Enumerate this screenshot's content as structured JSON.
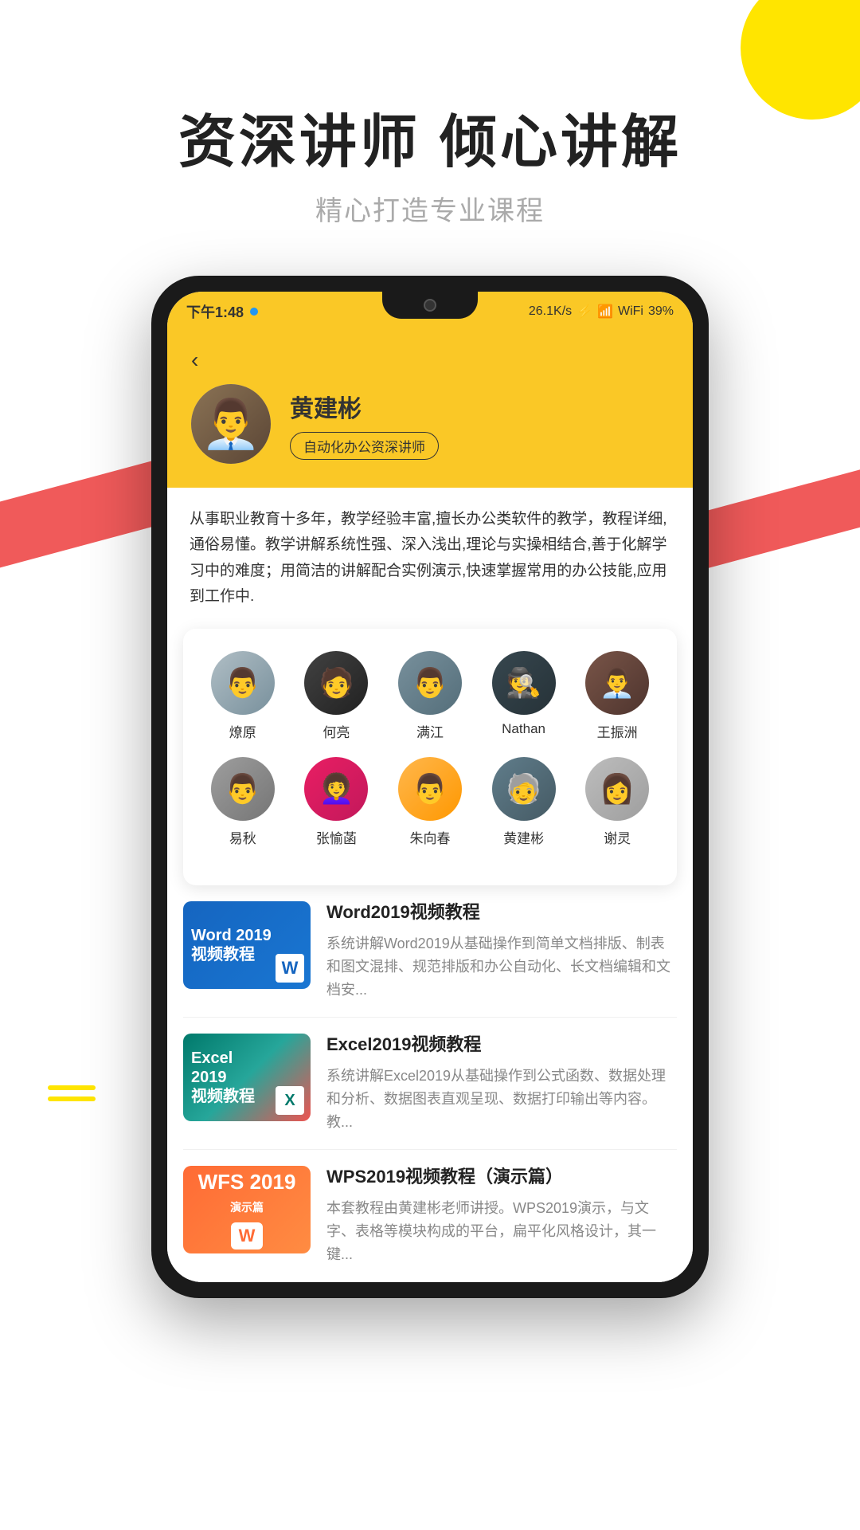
{
  "page": {
    "hero": {
      "title": "资深讲师  倾心讲解",
      "subtitle": "精心打造专业课程"
    },
    "phone": {
      "status_bar": {
        "time": "下午1:48",
        "speed": "26.1K/s",
        "battery": "39%"
      },
      "instructor": {
        "back_label": "‹",
        "name": "黄建彬",
        "badge": "自动化办公资深讲师",
        "description": "从事职业教育十多年，教学经验丰富,擅长办公类软件的教学，教程详细,通俗易懂。教学讲解系统性强、深入浅出,理论与实操相结合,善于化解学习中的难度；用简洁的讲解配合实例演示,快速掌握常用的办公技能,应用到工作中."
      },
      "teachers_row1": [
        {
          "name": "燎原",
          "emoji": "👨"
        },
        {
          "name": "何亮",
          "emoji": "🧑"
        },
        {
          "name": "满江",
          "emoji": "👨"
        },
        {
          "name": "Nathan",
          "emoji": "🕵️"
        },
        {
          "name": "王振洲",
          "emoji": "👨‍💼"
        }
      ],
      "teachers_row2": [
        {
          "name": "易秋",
          "emoji": "👨"
        },
        {
          "name": "张愉菡",
          "emoji": "👩‍🦱"
        },
        {
          "name": "朱向春",
          "emoji": "👨"
        },
        {
          "name": "黄建彬",
          "emoji": "🧓"
        },
        {
          "name": "谢灵",
          "emoji": "👩"
        }
      ],
      "courses": [
        {
          "id": "word2019",
          "thumb_type": "word",
          "title": "Word2019视频教程",
          "description": "系统讲解Word2019从基础操作到简单文档排版、制表和图文混排、规范排版和办公自动化、长文档编辑和文档安..."
        },
        {
          "id": "excel2019",
          "thumb_type": "excel",
          "title": "Excel2019视频教程",
          "description": "系统讲解Excel2019从基础操作到公式函数、数据处理和分析、数据图表直观呈现、数据打印输出等内容。教..."
        },
        {
          "id": "wps2019",
          "thumb_type": "wps",
          "title": "WPS2019视频教程（演示篇）",
          "description": "本套教程由黄建彬老师讲授。WPS2019演示，与文字、表格等模块构成的平台，扁平化风格设计，其一键..."
        }
      ]
    }
  }
}
